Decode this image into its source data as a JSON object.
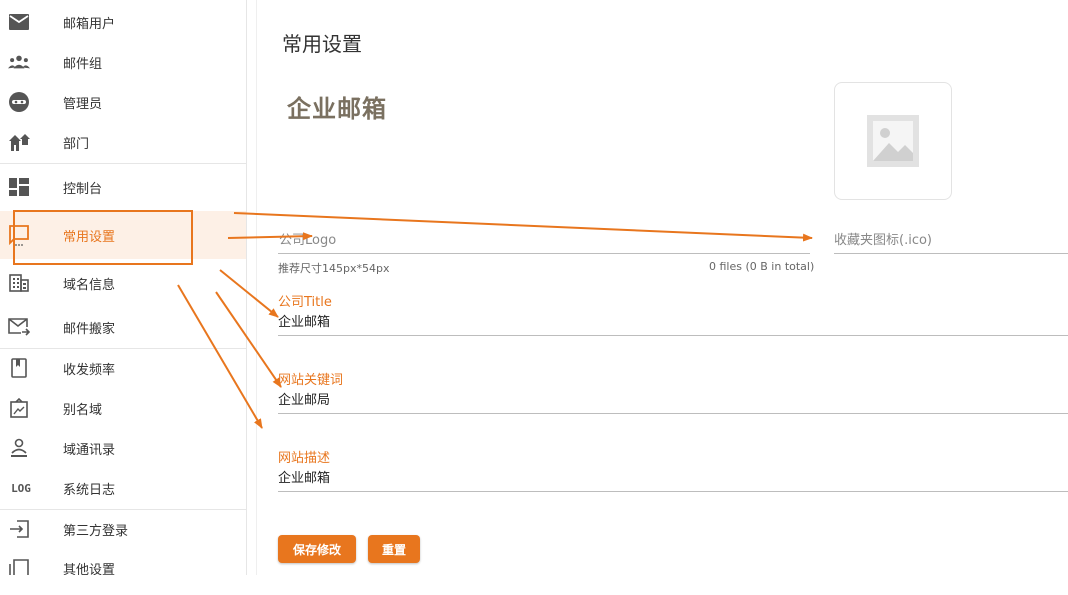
{
  "sidebar": {
    "items": [
      {
        "label": "邮箱用户",
        "icon": "mail-icon"
      },
      {
        "label": "邮件组",
        "icon": "group-icon"
      },
      {
        "label": "管理员",
        "icon": "admin-icon"
      },
      {
        "label": "部门",
        "icon": "department-icon"
      },
      {
        "label": "控制台",
        "icon": "dashboard-icon"
      },
      {
        "label": "常用设置",
        "icon": "settings-comment-icon"
      },
      {
        "label": "域名信息",
        "icon": "building-icon"
      },
      {
        "label": "邮件搬家",
        "icon": "mail-move-icon"
      },
      {
        "label": "收发频率",
        "icon": "bookmark-icon"
      },
      {
        "label": "别名域",
        "icon": "alias-icon"
      },
      {
        "label": "域通讯录",
        "icon": "contacts-icon"
      },
      {
        "label": "系统日志",
        "icon": "log-icon",
        "icon_text": "LOG"
      },
      {
        "label": "第三方登录",
        "icon": "login-icon"
      },
      {
        "label": "其他设置",
        "icon": "other-settings-icon"
      }
    ],
    "active_index": 5
  },
  "main": {
    "title": "常用设置",
    "logo_preview_text": "企业邮箱",
    "company_logo_label": "公司Logo",
    "logo_hint": "推荐尺寸145px*54px",
    "files_status": "0 files (0 B in total)",
    "favicon_label": "收藏夹图标(.ico)",
    "fields": [
      {
        "label": "公司Title",
        "value": "企业邮箱"
      },
      {
        "label": "网站关键词",
        "value": "企业邮局"
      },
      {
        "label": "网站描述",
        "value": "企业邮箱"
      }
    ],
    "save_label": "保存修改",
    "reset_label": "重置"
  },
  "colors": {
    "accent": "#e8761e",
    "active_bg": "#fdf0e6"
  }
}
